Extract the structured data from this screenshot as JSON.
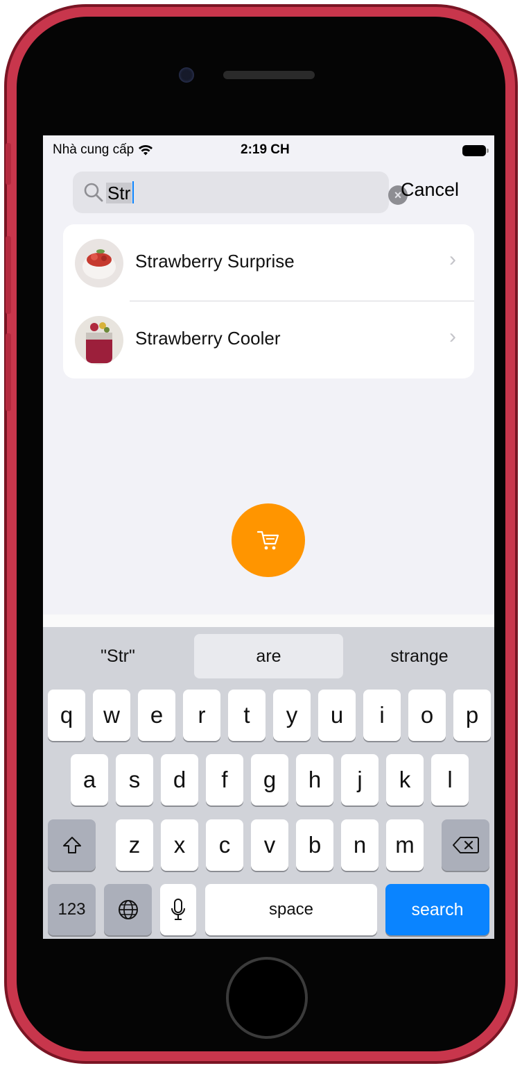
{
  "status_bar": {
    "carrier": "Nhà cung cấp",
    "time": "2:19 CH"
  },
  "search": {
    "query": "Str",
    "cancel_label": "Cancel"
  },
  "results": [
    {
      "title": "Strawberry Surprise"
    },
    {
      "title": "Strawberry Cooler"
    }
  ],
  "keyboard": {
    "suggestions": [
      "\"Str\"",
      "are",
      "strange"
    ],
    "row1": [
      "q",
      "w",
      "e",
      "r",
      "t",
      "y",
      "u",
      "i",
      "o",
      "p"
    ],
    "row2": [
      "a",
      "s",
      "d",
      "f",
      "g",
      "h",
      "j",
      "k",
      "l"
    ],
    "row3": [
      "z",
      "x",
      "c",
      "v",
      "b",
      "n",
      "m"
    ],
    "numbers_label": "123",
    "space_label": "space",
    "search_label": "search"
  },
  "colors": {
    "accent_orange": "#ff9500",
    "key_blue": "#0a84ff",
    "frame_red": "#c8364c"
  }
}
